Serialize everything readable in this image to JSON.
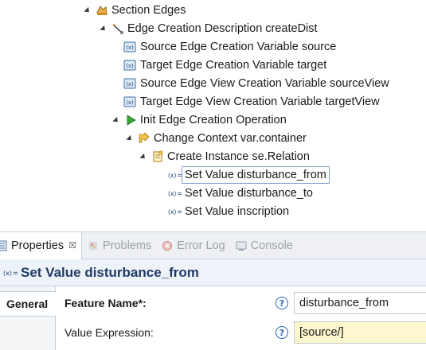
{
  "tree": {
    "items": [
      {
        "label": "Section Edges",
        "icon": "section-icon",
        "expanded": true
      },
      {
        "label": "Edge Creation Description createDist",
        "icon": "edge-creation-icon",
        "expanded": true
      },
      {
        "label": "Source Edge Creation Variable source",
        "icon": "variable-icon"
      },
      {
        "label": "Target Edge Creation Variable target",
        "icon": "variable-icon"
      },
      {
        "label": "Source Edge View Creation Variable sourceView",
        "icon": "variable-icon"
      },
      {
        "label": "Target Edge View Creation Variable targetView",
        "icon": "variable-icon"
      },
      {
        "label": "Init Edge Creation Operation",
        "icon": "play-icon",
        "expanded": true
      },
      {
        "label": "Change Context var.container",
        "icon": "change-context-icon",
        "expanded": true
      },
      {
        "label": "Create Instance se.Relation",
        "icon": "create-instance-icon",
        "expanded": true
      },
      {
        "label": "Set Value disturbance_from",
        "icon": "set-value-icon",
        "selected": true
      },
      {
        "label": "Set Value disturbance_to",
        "icon": "set-value-icon"
      },
      {
        "label": "Set Value inscription",
        "icon": "set-value-icon"
      }
    ]
  },
  "views": {
    "tabs": [
      {
        "label": "Properties",
        "icon": "properties-icon",
        "active": true,
        "close": "☒"
      },
      {
        "label": "Problems",
        "icon": "problems-icon"
      },
      {
        "label": "Error Log",
        "icon": "error-log-icon"
      },
      {
        "label": "Console",
        "icon": "console-icon"
      }
    ]
  },
  "properties": {
    "title": "Set Value disturbance_from",
    "side_tab": "General",
    "fields": [
      {
        "label": "Feature Name*:",
        "help": "?",
        "value": "disturbance_from"
      },
      {
        "label": "Value Expression:",
        "help": "?",
        "value": "[source/]"
      }
    ]
  },
  "colors": {
    "header_bg": "#eef3f9",
    "header_text": "#1f3b63",
    "selection_border": "#7da2ce",
    "expression_bg": "#fcf7cf",
    "help_blue": "#2b64b5"
  }
}
